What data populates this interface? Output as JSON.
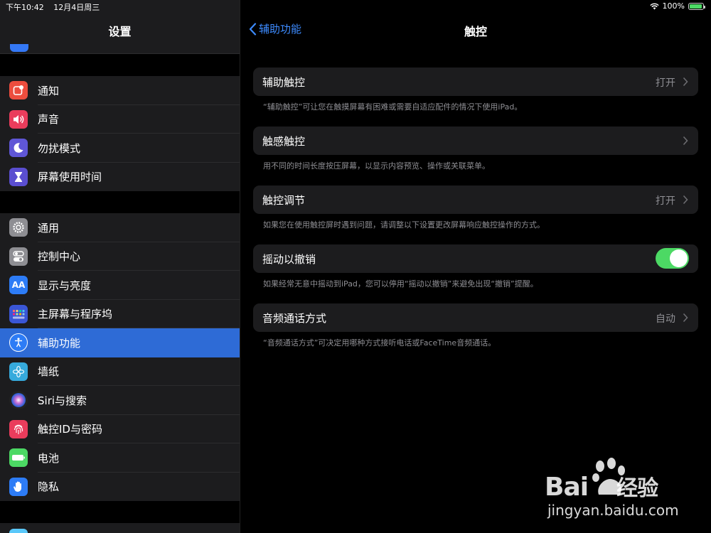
{
  "status": {
    "time": "下午10:42",
    "date": "12月4日周三",
    "battery": "100%"
  },
  "sidebar": {
    "title": "设置",
    "group1": [
      {
        "label": "通知",
        "icon": "notifications-icon",
        "color": "#ec4d3e"
      },
      {
        "label": "声音",
        "icon": "sound-icon",
        "color": "#ea3c5c"
      },
      {
        "label": "勿扰模式",
        "icon": "moon-icon",
        "color": "#5f56d6"
      },
      {
        "label": "屏幕使用时间",
        "icon": "hourglass-icon",
        "color": "#5a4ed0"
      }
    ],
    "group2": [
      {
        "label": "通用",
        "icon": "gear-icon",
        "color": "#8e8e93"
      },
      {
        "label": "控制中心",
        "icon": "switches-icon",
        "color": "#8e8e93"
      },
      {
        "label": "显示与亮度",
        "icon": "text-size-icon",
        "color": "#2d7cf6"
      },
      {
        "label": "主屏幕与程序坞",
        "icon": "grid-icon",
        "color": "#3a56d6"
      },
      {
        "label": "辅助功能",
        "icon": "accessibility-icon",
        "color": "#2d7cf6",
        "selected": true
      },
      {
        "label": "墙纸",
        "icon": "flower-icon",
        "color": "#36aadc"
      },
      {
        "label": "Siri与搜索",
        "icon": "siri-icon",
        "color": "#222"
      },
      {
        "label": "触控ID与密码",
        "icon": "fingerprint-icon",
        "color": "#ea3c5c"
      },
      {
        "label": "电池",
        "icon": "battery-icon",
        "color": "#4cd964"
      },
      {
        "label": "隐私",
        "icon": "hand-icon",
        "color": "#2d7cf6"
      }
    ]
  },
  "main": {
    "back_label": "辅助功能",
    "title": "触控",
    "cells": [
      {
        "title": "辅助触控",
        "value": "打开",
        "footnote": "“辅助触控”可让您在触摸屏幕有困难或需要自适应配件的情况下使用iPad。"
      },
      {
        "title": "触感触控",
        "value": "",
        "footnote": "用不同的时间长度按压屏幕，以显示内容预览、操作或关联菜单。"
      },
      {
        "title": "触控调节",
        "value": "打开",
        "footnote": "如果您在使用触控屏时遇到问题，请调整以下设置更改屏幕响应触控操作的方式。"
      },
      {
        "title": "摇动以撤销",
        "toggle": true,
        "footnote": "如果经常无意中摇动到iPad，您可以停用“摇动以撤销”来避免出现“撤销”提醒。"
      },
      {
        "title": "音频通话方式",
        "value": "自动",
        "footnote": "“音频通话方式”可决定用哪种方式接听电话或FaceTime音频通话。"
      }
    ]
  },
  "watermark": {
    "brand": "Bai",
    "brand_tail": "经验",
    "url": "jingyan.baidu.com"
  }
}
